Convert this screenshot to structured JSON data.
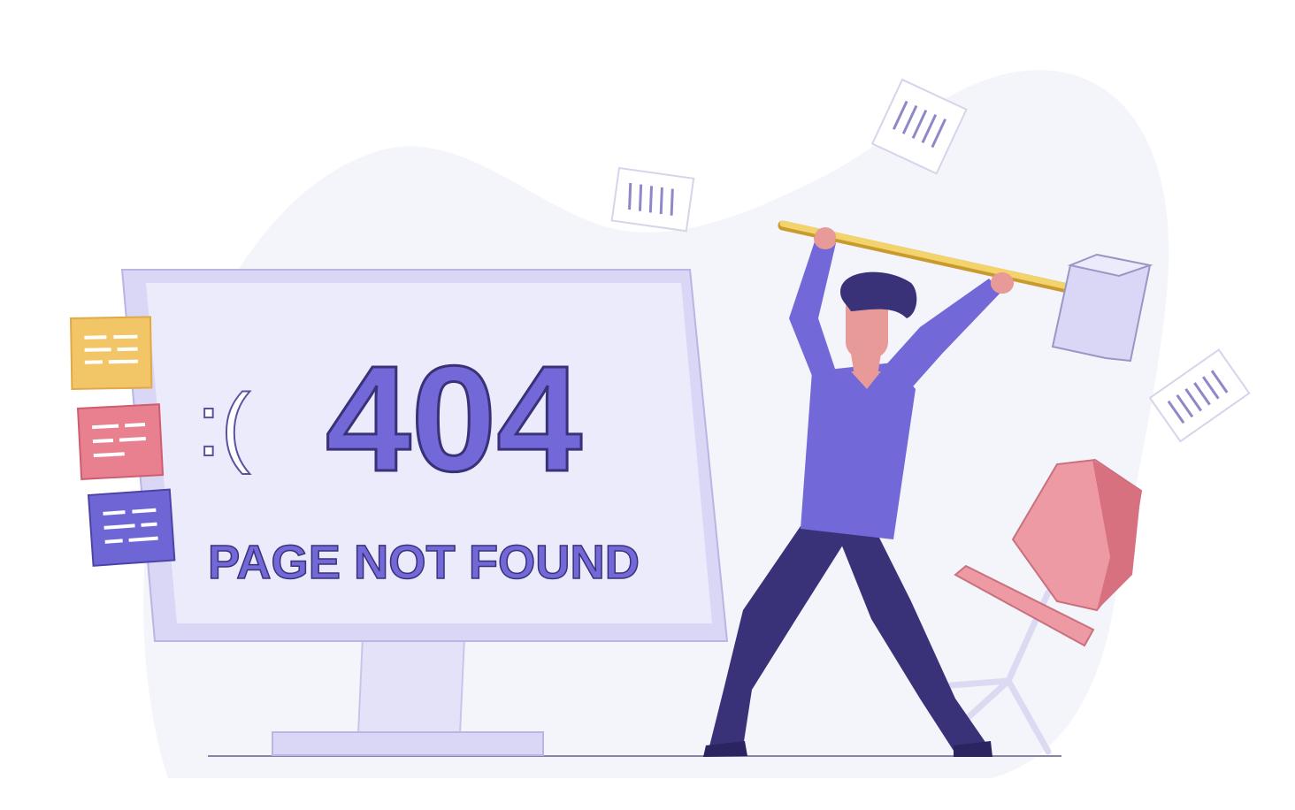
{
  "screen": {
    "emoticon": ":(",
    "error_code": "404",
    "message": "PAGE NOT FOUND"
  },
  "colors": {
    "accent": "#7368d8",
    "accent_dark": "#3a3278",
    "screen_bg": "#ecebfb",
    "monitor_frame": "#d9d6f6",
    "blob": "#f4f4fb",
    "note_yellow": "#f2c567",
    "note_pink": "#e9808f",
    "note_purple": "#6f66d6",
    "chair_pink": "#ee9aa5",
    "skin": "#e89a98",
    "hair": "#3a3278",
    "hammer_handle": "#f3d36b"
  },
  "icons": [
    "sticky-note-icon",
    "paper-sheet-icon",
    "sledgehammer-icon",
    "office-chair-icon"
  ]
}
